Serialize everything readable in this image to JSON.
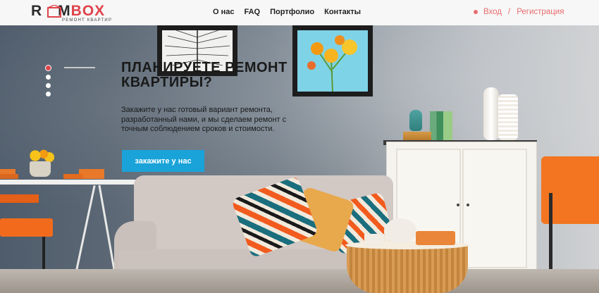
{
  "brand": {
    "name_dark_1": "R",
    "name_dark_2": "M",
    "name_red": "BOX",
    "tagline": "РЕМОНТ КВАРТИР"
  },
  "nav": {
    "items": [
      "О нас",
      "FAQ",
      "Портфолио",
      "Контакты"
    ]
  },
  "auth": {
    "login": "Вход",
    "separator": "/",
    "register": "Регистрация"
  },
  "hero": {
    "title": "ПЛАНИРУЕТЕ РЕМОНТ КВАРТИРЫ?",
    "text": "Закажите у нас готовый вариант ремонта, разработанный нами, и мы сделаем ремонт с точным соблюдением сроков и стоимости.",
    "cta": "закажите у нас",
    "slides_total": 4,
    "slide_active": 1
  },
  "colors": {
    "accent_red": "#e0434b",
    "cta_blue": "#1aa3d9",
    "auth_pink": "#e96d6f"
  }
}
